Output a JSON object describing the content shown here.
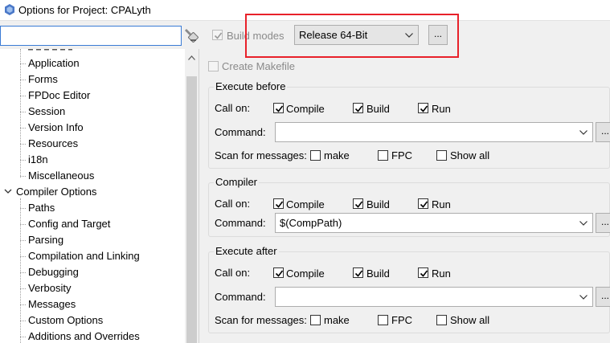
{
  "window": {
    "title": "Options for Project: CPALyth"
  },
  "search": {
    "value": "",
    "placeholder": ""
  },
  "tree": {
    "items": [
      {
        "label": "Application"
      },
      {
        "label": "Forms"
      },
      {
        "label": "FPDoc Editor"
      },
      {
        "label": "Session"
      },
      {
        "label": "Version Info"
      },
      {
        "label": "Resources"
      },
      {
        "label": "i18n"
      },
      {
        "label": "Miscellaneous"
      },
      {
        "label": "Compiler Options"
      },
      {
        "label": "Paths"
      },
      {
        "label": "Config and Target"
      },
      {
        "label": "Parsing"
      },
      {
        "label": "Compilation and Linking"
      },
      {
        "label": "Debugging"
      },
      {
        "label": "Verbosity"
      },
      {
        "label": "Messages"
      },
      {
        "label": "Custom Options"
      },
      {
        "label": "Additions and Overrides"
      }
    ]
  },
  "build_modes": {
    "label": "Build modes",
    "checked": true,
    "selected": "Release 64-Bit",
    "dots_label": "..."
  },
  "create_makefile": {
    "label": "Create Makefile",
    "checked": false
  },
  "execute_before": {
    "title": "Execute before",
    "call_on_label": "Call on:",
    "compile_label": "Compile",
    "build_label": "Build",
    "run_label": "Run",
    "command_label": "Command:",
    "command_value": "",
    "dots_label": "...",
    "scan_label": "Scan for messages:",
    "make_label": "make",
    "fpc_label": "FPC",
    "show_all_label": "Show all"
  },
  "compiler": {
    "title": "Compiler",
    "call_on_label": "Call on:",
    "compile_label": "Compile",
    "build_label": "Build",
    "run_label": "Run",
    "command_label": "Command:",
    "command_value": "$(CompPath)",
    "dots_label": "..."
  },
  "execute_after": {
    "title": "Execute after",
    "call_on_label": "Call on:",
    "compile_label": "Compile",
    "build_label": "Build",
    "run_label": "Run",
    "command_label": "Command:",
    "command_value": "",
    "dots_label": "...",
    "scan_label": "Scan for messages:",
    "make_label": "make",
    "fpc_label": "FPC",
    "show_all_label": "Show all"
  },
  "colors": {
    "highlight": "#e8212a",
    "search_border": "#3a7bd5"
  }
}
